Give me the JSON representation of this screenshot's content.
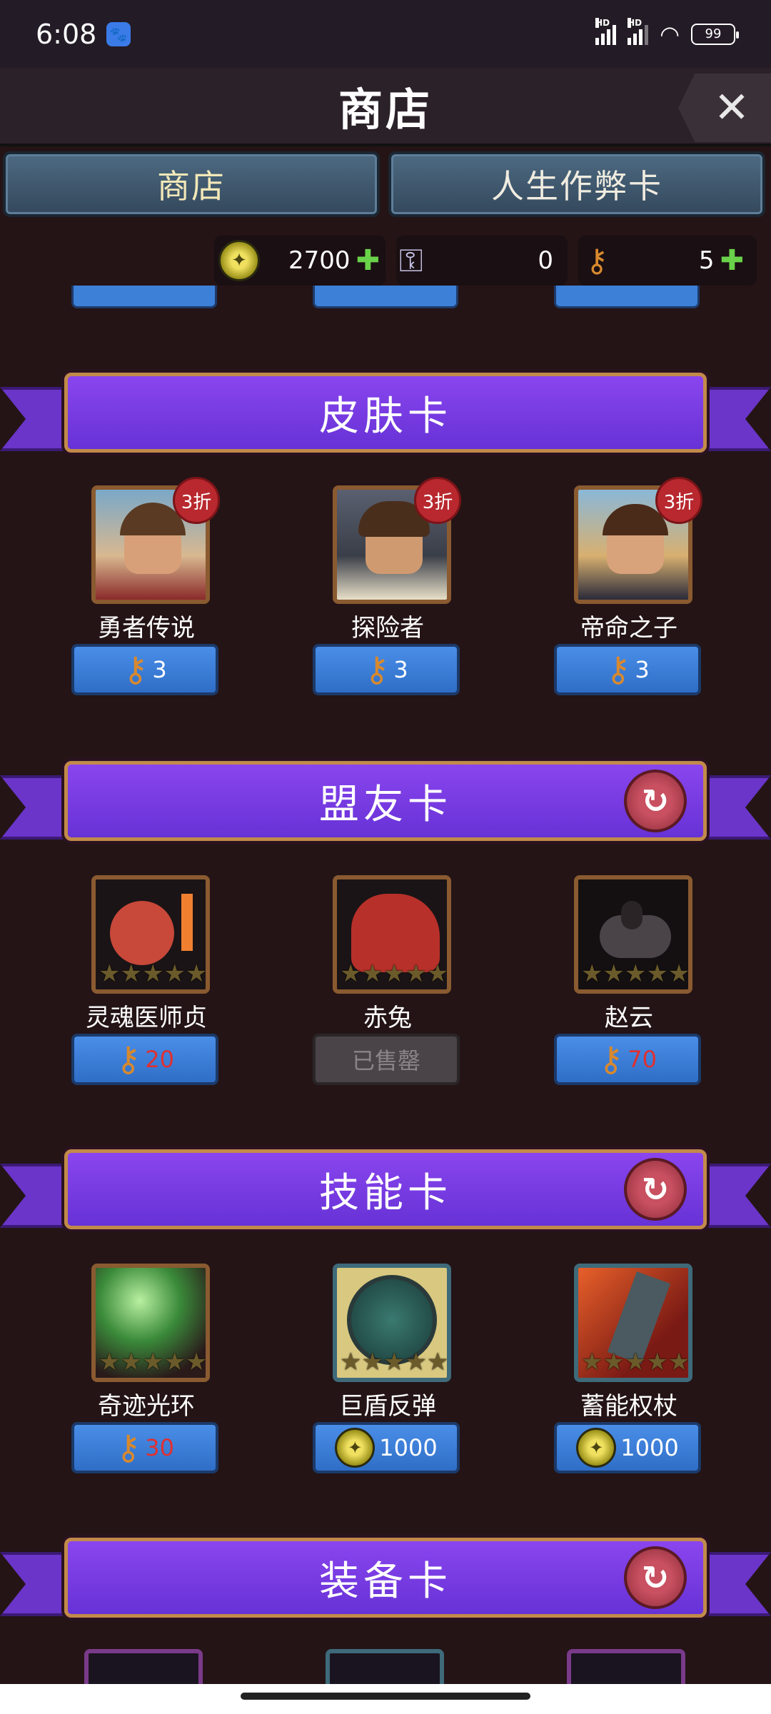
{
  "status": {
    "time": "6:08",
    "battery": "99",
    "signal1": "HD",
    "signal2": "HD"
  },
  "header": {
    "title": "商店"
  },
  "tabs": [
    {
      "label": "商店"
    },
    {
      "label": "人生作弊卡"
    }
  ],
  "currency": {
    "gold": "2700",
    "silver_keys": "0",
    "gold_keys": "5"
  },
  "sections": {
    "skin": {
      "title": "皮肤卡"
    },
    "ally": {
      "title": "盟友卡"
    },
    "skill": {
      "title": "技能卡"
    },
    "equip": {
      "title": "装备卡"
    }
  },
  "skin_cards": [
    {
      "name": "勇者传说",
      "discount": "3折",
      "price": "3"
    },
    {
      "name": "探险者",
      "discount": "3折",
      "price": "3"
    },
    {
      "name": "帝命之子",
      "discount": "3折",
      "price": "3"
    }
  ],
  "ally_cards": [
    {
      "name": "灵魂医师贞",
      "price": "20"
    },
    {
      "name": "赤兔",
      "price": "已售罄"
    },
    {
      "name": "赵云",
      "price": "70"
    }
  ],
  "skill_cards": [
    {
      "name": "奇迹光环",
      "price": "30"
    },
    {
      "name": "巨盾反弹",
      "price": "1000"
    },
    {
      "name": "蓄能权杖",
      "price": "1000"
    }
  ],
  "colors": {
    "ribbon": "#7a3ce0",
    "button": "#3f7ed8",
    "discount": "#b8282e"
  }
}
